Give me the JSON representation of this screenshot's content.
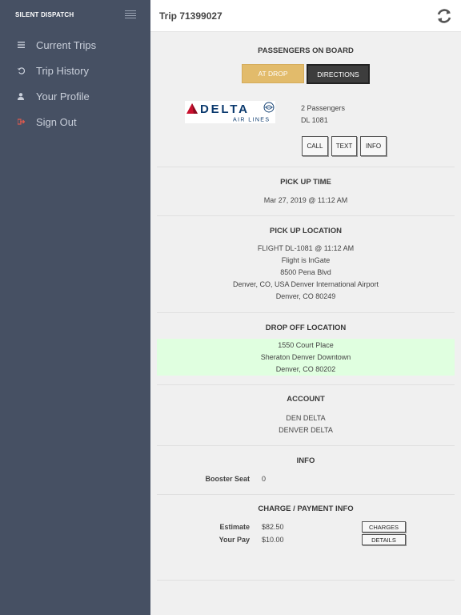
{
  "sidebar": {
    "brand": "SILENT DISPATCH",
    "items": [
      {
        "label": "Current Trips",
        "icon": "list-icon"
      },
      {
        "label": "Trip History",
        "icon": "history-icon"
      },
      {
        "label": "Your Profile",
        "icon": "user-icon"
      },
      {
        "label": "Sign Out",
        "icon": "sign-out-icon"
      }
    ]
  },
  "header": {
    "title": "Trip 71399027"
  },
  "status": {
    "heading": "PASSENGERS ON BOARD",
    "at_drop_label": "AT DROP",
    "directions_label": "DIRECTIONS"
  },
  "airline": {
    "logo_name": "DELTA",
    "logo_sub": "AIR LINES",
    "passengers": "2 Passengers",
    "flight": "DL 1081",
    "call_label": "CALL",
    "text_label": "TEXT",
    "info_label": "INFO"
  },
  "pickup_time": {
    "heading": "PICK UP TIME",
    "value": "Mar 27, 2019 @ 11:12 AM"
  },
  "pickup_location": {
    "heading": "PICK UP LOCATION",
    "lines": [
      "FLIGHT DL-1081 @ 11:12 AM",
      "Flight is InGate",
      "8500 Pena Blvd",
      "Denver, CO, USA Denver International Airport",
      "Denver, CO 80249"
    ]
  },
  "dropoff_location": {
    "heading": "DROP OFF LOCATION",
    "lines": [
      "1550 Court Place",
      "Sheraton Denver Downtown",
      "Denver, CO 80202"
    ]
  },
  "account": {
    "heading": "ACCOUNT",
    "lines": [
      "DEN DELTA",
      "DENVER DELTA"
    ]
  },
  "info": {
    "heading": "INFO",
    "label": "Booster Seat",
    "value": "0"
  },
  "payment": {
    "heading": "CHARGE / PAYMENT INFO",
    "estimate_label": "Estimate",
    "estimate_value": "$82.50",
    "pay_label": "Your Pay",
    "pay_value": "$10.00",
    "charges_label": "CHARGES",
    "details_label": "DETAILS"
  },
  "colors": {
    "sidebar_bg": "#465063",
    "at_drop_bg": "#e2bb6b",
    "directions_bg": "#3d3d3d",
    "drop_highlight": "#e0ffe0",
    "delta_red": "#c8102e",
    "delta_blue": "#0b3a6e"
  }
}
